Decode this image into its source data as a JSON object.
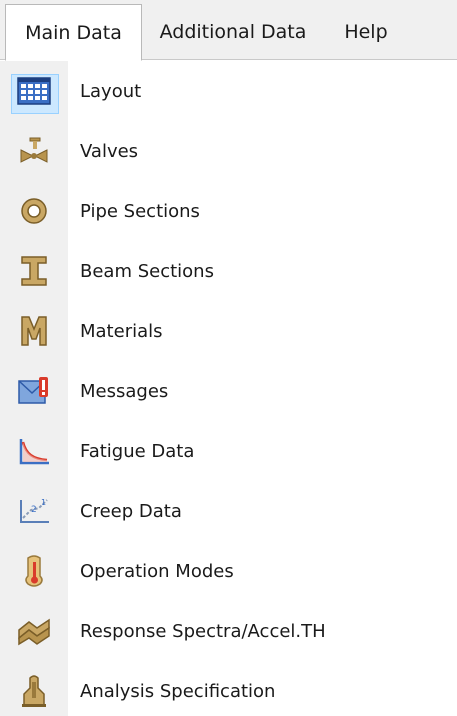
{
  "menubar": {
    "tabs": [
      {
        "label": "Main Data",
        "active": true
      },
      {
        "label": "Additional Data",
        "active": false
      },
      {
        "label": "Help",
        "active": false
      }
    ]
  },
  "items": [
    {
      "label": "Layout",
      "icon": "layout-grid-icon",
      "selected": true
    },
    {
      "label": "Valves",
      "icon": "valve-icon",
      "selected": false
    },
    {
      "label": "Pipe Sections",
      "icon": "pipe-section-icon",
      "selected": false
    },
    {
      "label": "Beam Sections",
      "icon": "beam-section-icon",
      "selected": false
    },
    {
      "label": "Materials",
      "icon": "materials-icon",
      "selected": false
    },
    {
      "label": "Messages",
      "icon": "messages-icon",
      "selected": false
    },
    {
      "label": "Fatigue Data",
      "icon": "fatigue-curve-icon",
      "selected": false
    },
    {
      "label": "Creep Data",
      "icon": "creep-data-icon",
      "selected": false
    },
    {
      "label": "Operation Modes",
      "icon": "thermometer-icon",
      "selected": false
    },
    {
      "label": "Response Spectra/Accel.TH",
      "icon": "response-spectra-icon",
      "selected": false
    },
    {
      "label": "Analysis Specification",
      "icon": "analysis-spec-icon",
      "selected": false
    }
  ],
  "colors": {
    "selection": "#cce8ff",
    "selection_border": "#99d1ff",
    "icon_bronze": "#b8944e",
    "icon_blue": "#3b6fc4",
    "icon_red": "#d93b2b"
  }
}
